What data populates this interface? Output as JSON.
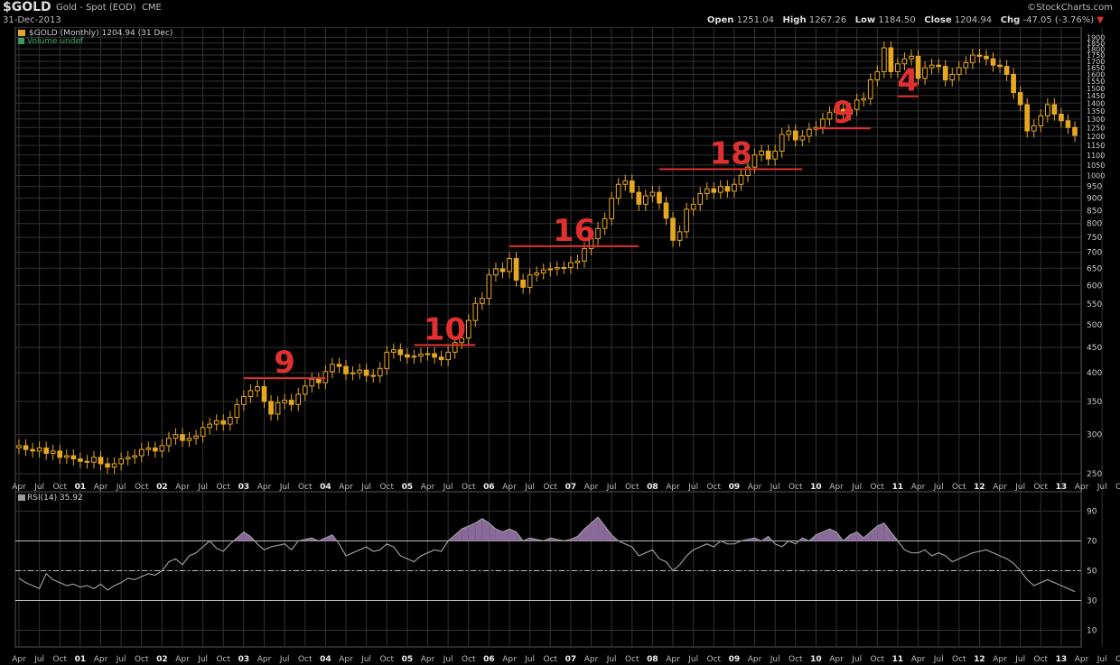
{
  "header": {
    "symbol": "$GOLD",
    "description": "Gold - Spot (EOD)",
    "exchange": "CME",
    "date": "31-Dec-2013",
    "brand": "©StockCharts.com",
    "open_label": "Open",
    "open": "1251.04",
    "high_label": "High",
    "high": "1267.26",
    "low_label": "Low",
    "low": "1184.50",
    "close_label": "Close",
    "close": "1204.94",
    "chg_label": "Chg",
    "chg": "-47.05 (-3.76%)",
    "chg_arrow": "▼"
  },
  "price_legend": "$GOLD (Monthly) 1204.94 (31 Dec)",
  "volume_legend": "Volume undef",
  "rsi_legend": "RSI(14) 35.92",
  "colors": {
    "up": "#e6a822",
    "down": "#e6a822",
    "annotation": "#e03030",
    "rsi_line": "#9a9a9a",
    "rsi_fill": "#8a6a9a",
    "grid": "#333333"
  },
  "chart_data": [
    {
      "type": "candlestick",
      "title": "$GOLD (Monthly) 1204.94 (31 Dec)",
      "scale": "log",
      "ylim": [
        245,
        1960
      ],
      "y_ticks": [
        250,
        300,
        350,
        400,
        450,
        500,
        550,
        600,
        650,
        700,
        750,
        800,
        850,
        900,
        950,
        1000,
        1050,
        1100,
        1150,
        1200,
        1250,
        1300,
        1350,
        1400,
        1450,
        1500,
        1550,
        1600,
        1650,
        1700,
        1750,
        1800,
        1850,
        1900
      ],
      "x_start": "2000-04",
      "x_end": "2013-12",
      "x_tick_labels": [
        "Apr",
        "Jul",
        "Oct",
        "01",
        "Apr",
        "Jul",
        "Oct",
        "02",
        "Apr",
        "Jul",
        "Oct",
        "03",
        "Apr",
        "Jul",
        "Oct",
        "04",
        "Apr",
        "Jul",
        "Oct",
        "05",
        "Apr",
        "Jul",
        "Oct",
        "06",
        "Apr",
        "Jul",
        "Oct",
        "07",
        "Apr",
        "Jul",
        "Oct",
        "08",
        "Apr",
        "Jul",
        "Oct",
        "09",
        "Apr",
        "Jul",
        "Oct",
        "10",
        "Apr",
        "Jul",
        "Oct",
        "11",
        "Apr",
        "Jul",
        "Oct",
        "12",
        "Apr",
        "Jul",
        "Oct",
        "13",
        "Apr",
        "Jul",
        "Oct"
      ],
      "closes": [
        285,
        280,
        278,
        282,
        275,
        278,
        270,
        272,
        268,
        265,
        264,
        270,
        262,
        258,
        262,
        268,
        270,
        272,
        280,
        282,
        278,
        285,
        295,
        300,
        292,
        295,
        298,
        310,
        315,
        320,
        315,
        325,
        345,
        358,
        368,
        375,
        350,
        330,
        348,
        352,
        345,
        362,
        376,
        388,
        382,
        402,
        416,
        412,
        398,
        400,
        405,
        395,
        394,
        408,
        440,
        445,
        435,
        430,
        432,
        436,
        437,
        430,
        425,
        440,
        460,
        470,
        510,
        552,
        565,
        630,
        648,
        640,
        680,
        615,
        595,
        630,
        636,
        645,
        648,
        652,
        652,
        667,
        672,
        712,
        746,
        782,
        818,
        900,
        960,
        975,
        925,
        875,
        910,
        925,
        880,
        820,
        740,
        770,
        855,
        875,
        920,
        940,
        925,
        950,
        930,
        960,
        1000,
        1040,
        1100,
        1120,
        1080,
        1120,
        1210,
        1230,
        1180,
        1200,
        1240,
        1250,
        1300,
        1340,
        1360,
        1330,
        1360,
        1420,
        1430,
        1560,
        1620,
        1810,
        1620,
        1680,
        1720,
        1740,
        1570,
        1650,
        1670,
        1660,
        1560,
        1600,
        1650,
        1690,
        1750,
        1740,
        1720,
        1670,
        1660,
        1600,
        1470,
        1390,
        1230,
        1260,
        1320,
        1390,
        1330,
        1290,
        1250,
        1204.94
      ],
      "annotations": [
        {
          "label": "9",
          "level": 390,
          "from": "2003-01",
          "to": "2004-01"
        },
        {
          "label": "10",
          "level": 455,
          "from": "2005-02",
          "to": "2005-11"
        },
        {
          "label": "16",
          "level": 720,
          "from": "2006-04",
          "to": "2007-11"
        },
        {
          "label": "18",
          "level": 1030,
          "from": "2008-02",
          "to": "2009-11"
        },
        {
          "label": "9",
          "level": 1245,
          "from": "2010-01",
          "to": "2010-09"
        },
        {
          "label": "4",
          "level": 1445,
          "from": "2011-01",
          "to": "2011-04"
        }
      ]
    },
    {
      "type": "line",
      "title": "RSI(14) 35.92",
      "ylim": [
        0,
        100
      ],
      "y_ticks": [
        10,
        30,
        50,
        70,
        90
      ],
      "reference_lines": [
        30,
        50,
        70
      ],
      "fill_above": 70,
      "values": [
        45,
        42,
        40,
        38,
        48,
        44,
        42,
        40,
        41,
        39,
        40,
        38,
        41,
        37,
        40,
        42,
        45,
        44,
        46,
        48,
        47,
        50,
        56,
        58,
        54,
        60,
        62,
        66,
        70,
        65,
        63,
        68,
        72,
        76,
        73,
        68,
        64,
        66,
        67,
        68,
        64,
        70,
        71,
        72,
        70,
        72,
        74,
        68,
        60,
        62,
        64,
        66,
        63,
        64,
        68,
        66,
        60,
        58,
        56,
        60,
        62,
        64,
        63,
        70,
        74,
        78,
        80,
        82,
        85,
        82,
        78,
        76,
        78,
        76,
        70,
        72,
        71,
        70,
        72,
        71,
        70,
        71,
        73,
        78,
        82,
        86,
        80,
        74,
        70,
        68,
        66,
        60,
        62,
        64,
        58,
        56,
        50,
        54,
        60,
        64,
        66,
        68,
        66,
        70,
        68,
        68,
        70,
        71,
        72,
        70,
        73,
        68,
        66,
        70,
        68,
        72,
        70,
        74,
        76,
        78,
        76,
        70,
        74,
        76,
        72,
        76,
        80,
        82,
        76,
        70,
        64,
        62,
        62,
        64,
        60,
        62,
        60,
        56,
        58,
        60,
        62,
        63,
        64,
        62,
        60,
        58,
        55,
        50,
        44,
        40,
        42,
        44,
        42,
        40,
        38,
        35.92
      ]
    }
  ]
}
